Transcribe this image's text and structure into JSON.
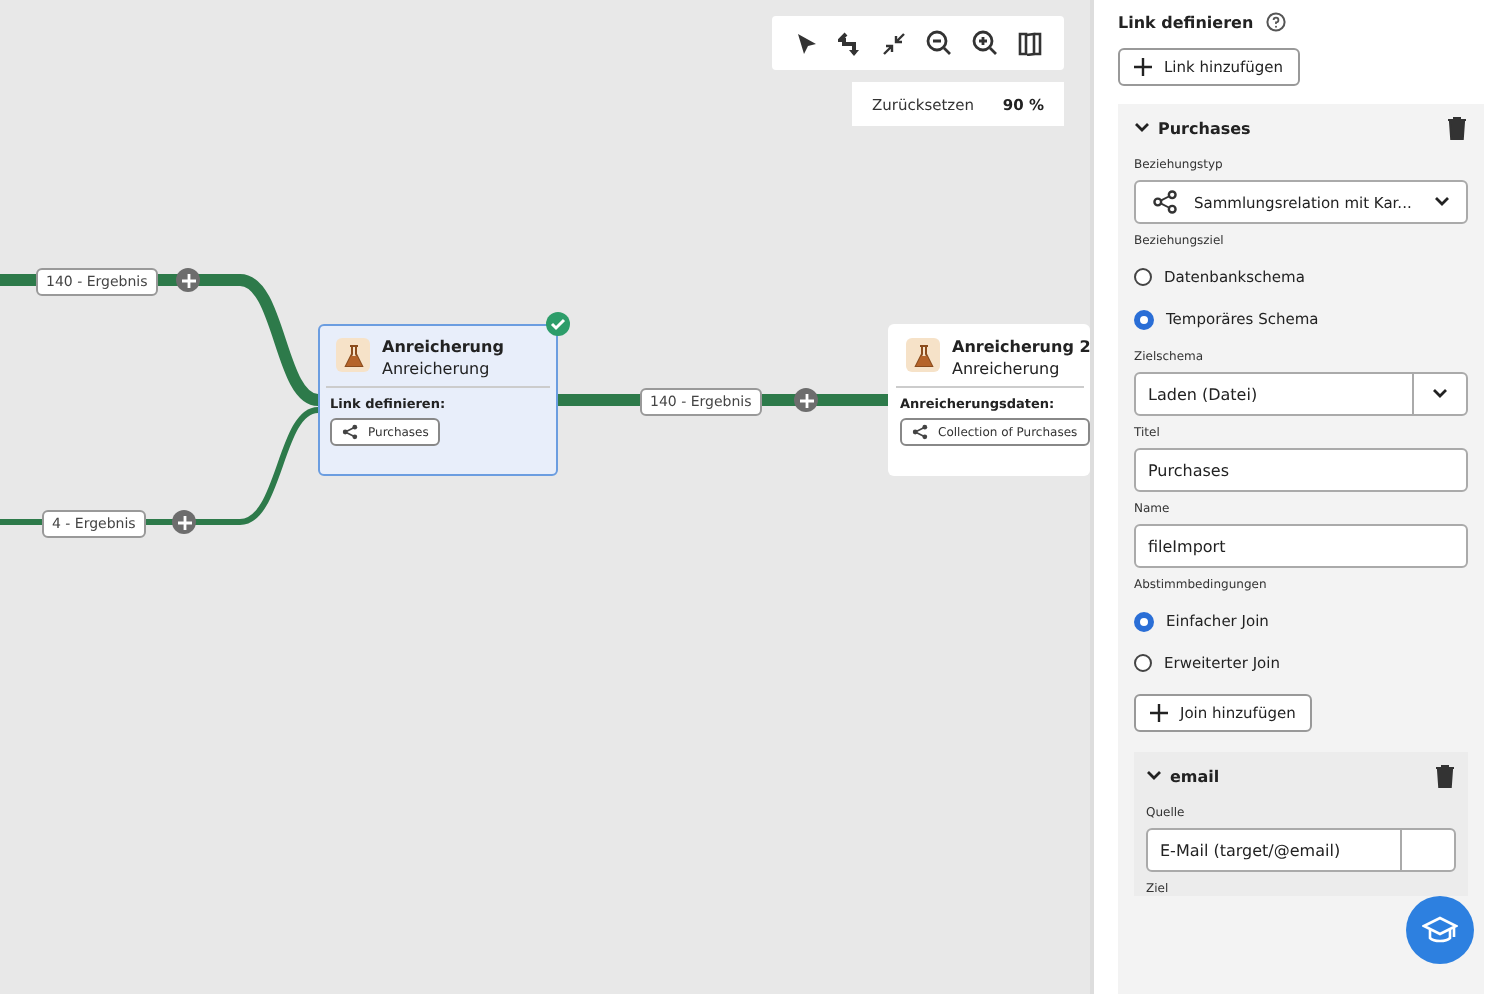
{
  "canvas": {
    "zoom": {
      "reset": "Zurücksetzen",
      "value": "90 %"
    },
    "edges": [
      {
        "label": "140 - Ergebnis"
      },
      {
        "label": "4 - Ergebnis"
      },
      {
        "label": "140 - Ergebnis"
      }
    ],
    "nodes": [
      {
        "title": "Anreicherung",
        "subtitle": "Anreicherung",
        "section": "Link definieren:",
        "chip": "Purchases",
        "selected": true,
        "valid": true
      },
      {
        "title": "Anreicherung 2",
        "subtitle": "Anreicherung",
        "section": "Anreicherungsdaten:",
        "chip": "Collection of Purchases",
        "selected": false,
        "valid": false
      }
    ]
  },
  "panel": {
    "title": "Link definieren",
    "add_link": "Link hinzufügen",
    "link": {
      "name": "Purchases",
      "expanded": true,
      "relation_label": "Beziehungstyp",
      "relation_value": "Sammlungsrelation mit Kar...",
      "target_label": "Beziehungsziel",
      "targets": [
        {
          "label": "Datenbankschema",
          "selected": false
        },
        {
          "label": "Temporäres Schema",
          "selected": true
        }
      ],
      "schema_label": "Zielschema",
      "schema_value": "Laden (Datei)",
      "title_label": "Titel",
      "title_value": "Purchases",
      "name_label": "Name",
      "name_value": "fileImport",
      "conditions_label": "Abstimmbedingungen",
      "conditions": [
        {
          "label": "Einfacher Join",
          "selected": true
        },
        {
          "label": "Erweiterter Join",
          "selected": false
        }
      ],
      "add_join": "Join hinzufügen",
      "join": {
        "name": "email",
        "expanded": true,
        "source_label": "Quelle",
        "source_value": "E-Mail (target/@email)",
        "dest_label": "Ziel"
      }
    }
  }
}
